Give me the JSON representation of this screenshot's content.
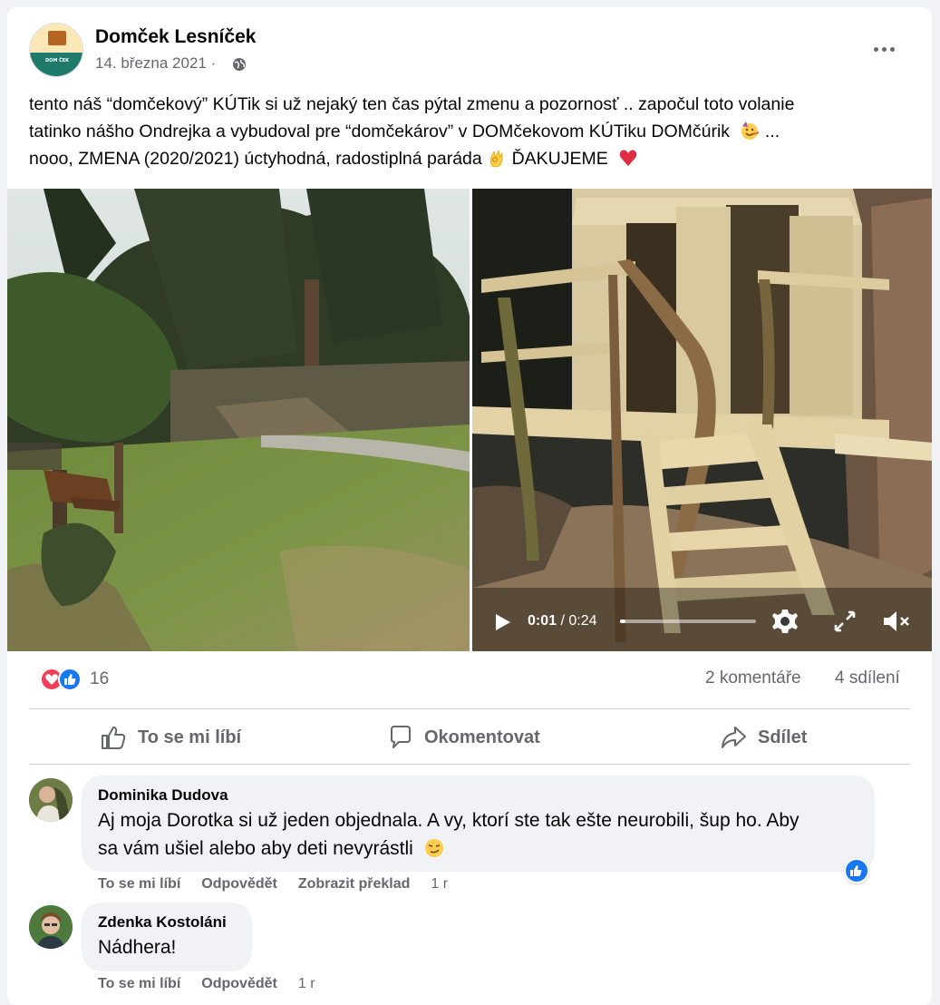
{
  "post": {
    "page_name": "Domček Lesníček",
    "date": "14. března 2021 ·",
    "avatar_text": "DOM ČEK",
    "text_line1": "tento náš “domčekový” KÚTik si už nejaký ten čas pýtal zmenu a pozornosť .. započul toto volanie",
    "text_line2": "tatinko nášho Ondrejka a vybudoval pre “domčekárov” v DOMčekovom KÚTiku DOMčúrik",
    "text_line2_tail": " ...",
    "text_line3a": "nooo, ZMENA (2020/2021) úctyhodná, radostiplná paráda",
    "text_line3b": " ĎAKUJEME",
    "emoji_1": "partying-face-emoji",
    "emoji_2": "ok-hand-emoji",
    "emoji_3": "red-heart-emoji"
  },
  "video": {
    "current_time": "0:01",
    "separator": " / ",
    "duration": "0:24",
    "progress": 0.04
  },
  "stats": {
    "reactions": "16",
    "comments": "2 komentáře",
    "shares": "4 sdílení"
  },
  "actions": {
    "like": "To se mi líbí",
    "comment": "Okomentovat",
    "share": "Sdílet"
  },
  "comments": [
    {
      "name": "Dominika Dudova",
      "text_line1": "Aj moja Dorotka si už jeden objednala. A vy, ktorí ste tak ešte neurobili, šup ho. Aby",
      "text_line2": "sa vám ušiel alebo aby deti nevyrástli",
      "emoji": "smirking-face-emoji",
      "like": "To se mi líbí",
      "reply": "Odpovědět",
      "translate": "Zobrazit překlad",
      "time": "1 r"
    },
    {
      "name": "Zdenka Kostoláni",
      "text_line1": "Nádhera!",
      "like": "To se mi líbí",
      "reply": "Odpovědět",
      "time": "1 r"
    }
  ],
  "colors": {
    "accent": "#1877f2",
    "love": "#f33e58",
    "secondary_text": "#65676b"
  }
}
